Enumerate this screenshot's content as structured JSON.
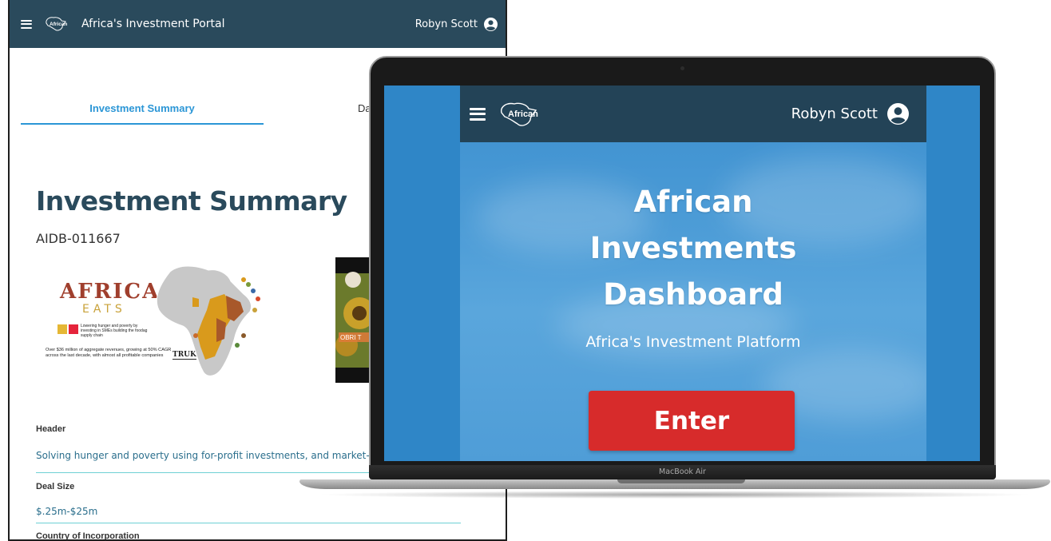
{
  "portal": {
    "logo_text": "African",
    "title": "Africa's Investment Portal",
    "user_name": "Robyn Scott",
    "tabs": [
      {
        "label": "Investment Summary",
        "active": true
      },
      {
        "label": "Da",
        "active": false
      }
    ],
    "heading": "Investment Summary",
    "id": "AIDB-011667",
    "africa_eats": {
      "logo_top": "AFRICA",
      "logo_bottom": "EATS",
      "tagline": "Lowering hunger and poverty by investing in SMEs building the foodag supply chain",
      "stats": "Over $36 million of aggregate revenues, growing at 50% CAGR across the last decade, with almost all profitable companies",
      "truk": "TRUK"
    },
    "photo_caption": "OBRI T",
    "fields": [
      {
        "label": "Header",
        "value": "Solving hunger and poverty using for-profit investments, and market-beating"
      },
      {
        "label": "Deal Size",
        "value": "$.25m-$25m"
      },
      {
        "label": "Country of Incorporation",
        "value": ""
      }
    ]
  },
  "laptop": {
    "model": "MacBook Air",
    "app": {
      "logo_text": "African",
      "user_name": "Robyn Scott",
      "title_line1": "African",
      "title_line2": "Investments",
      "title_line3": "Dashboard",
      "subtitle": "Africa's Investment Platform",
      "enter_label": "Enter"
    }
  },
  "colors": {
    "navbar": "#2a4a5c",
    "accent_blue": "#2b96d6",
    "teal_line": "#6ed0d4",
    "enter_red": "#d72b2b",
    "screen_blue": "#2f86c7"
  },
  "icons": [
    "hamburger-menu-icon",
    "africa-logo-icon",
    "user-circle-icon"
  ]
}
